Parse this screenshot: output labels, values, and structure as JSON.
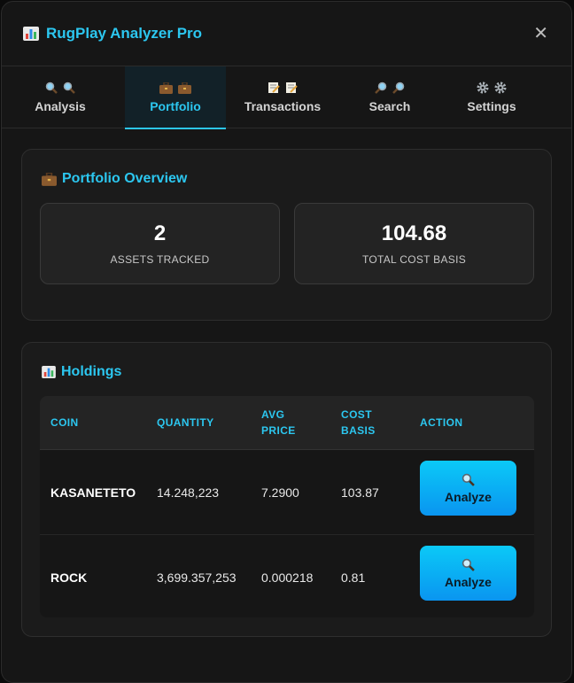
{
  "app": {
    "title": "RugPlay Analyzer Pro",
    "close_symbol": "✕"
  },
  "tabs": [
    {
      "label": "Analysis",
      "icon": "magnifier-icon",
      "active": false
    },
    {
      "label": "Portfolio",
      "icon": "briefcase-icon",
      "active": true
    },
    {
      "label": "Transactions",
      "icon": "memo-icon",
      "active": false
    },
    {
      "label": "Search",
      "icon": "magnifier-right-icon",
      "active": false
    },
    {
      "label": "Settings",
      "icon": "gear-icon",
      "active": false
    }
  ],
  "overview": {
    "title": "Portfolio Overview",
    "stats": [
      {
        "value": "2",
        "label": "ASSETS TRACKED"
      },
      {
        "value": "104.68",
        "label": "TOTAL COST BASIS"
      }
    ]
  },
  "holdings": {
    "title": "Holdings",
    "columns": [
      "COIN",
      "QUANTITY",
      "AVG",
      "PRICE",
      "COST",
      "BASIS",
      "ACTION"
    ],
    "rows": [
      {
        "coin": "KASANETETO",
        "quantity": "14.248,223",
        "avg_price": "7.2900",
        "cost_basis": "103.87",
        "action": "Analyze"
      },
      {
        "coin": "ROCK",
        "quantity": "3,699.357,253",
        "avg_price": "0.000218",
        "cost_basis": "0.81",
        "action": "Analyze"
      }
    ]
  },
  "colors": {
    "accent": "#2cc7f0",
    "button": "#0a95f0",
    "background": "#161616"
  }
}
